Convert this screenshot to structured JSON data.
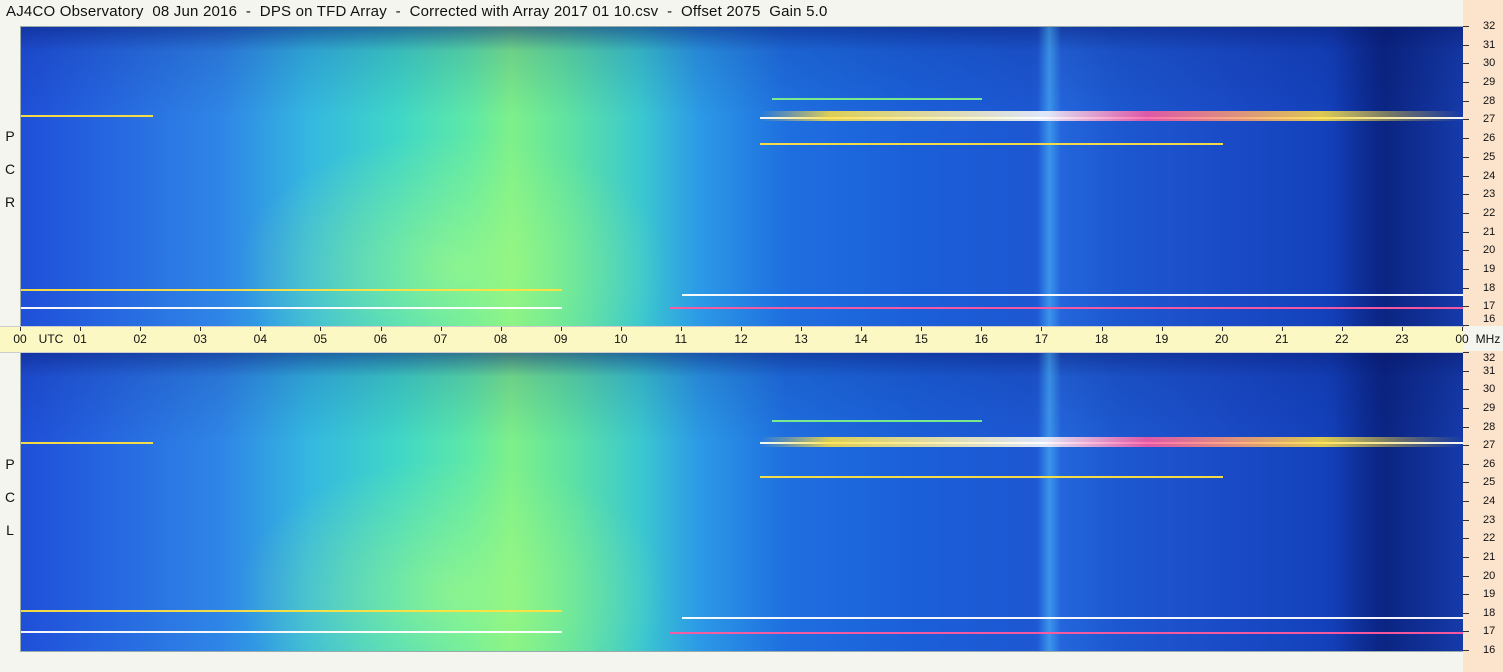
{
  "title": "AJ4CO Observatory  08 Jun 2016  -  DPS on TFD Array  -  Corrected with Array 2017 01 10.csv  -  Offset 2075  Gain 5.0",
  "time_axis": {
    "labels": [
      "00",
      "UTC",
      "01",
      "02",
      "03",
      "04",
      "05",
      "06",
      "07",
      "08",
      "09",
      "10",
      "11",
      "12",
      "13",
      "14",
      "15",
      "16",
      "17",
      "18",
      "19",
      "20",
      "21",
      "22",
      "23",
      "00",
      "MHz"
    ]
  },
  "panels": [
    {
      "polarization_letters": [
        "R",
        "C",
        "P"
      ]
    },
    {
      "polarization_letters": [
        "L",
        "C",
        "P"
      ]
    }
  ],
  "colors": {
    "background": "#f5f5f0",
    "time_axis_bg": "#fbf8c4",
    "freq_axis_bg": "#fbe3cc",
    "spectrum_low": "#0f35aa",
    "spectrum_mid": "#34b8e0",
    "spectrum_high": "#7ef08a",
    "burst_white": "#ffffff",
    "burst_magenta": "#ff5aa0",
    "burst_yellow": "#ffe040"
  },
  "chart_data": [
    {
      "type": "heatmap",
      "title": "",
      "xlabel": "UTC",
      "ylabel": "MHz",
      "x_ticks": [
        "00",
        "01",
        "02",
        "03",
        "04",
        "05",
        "06",
        "07",
        "08",
        "09",
        "10",
        "11",
        "12",
        "13",
        "14",
        "15",
        "16",
        "17",
        "18",
        "19",
        "20",
        "21",
        "22",
        "23",
        "00"
      ],
      "y_ticks": [
        32,
        31,
        30,
        29,
        28,
        27,
        26,
        25,
        24,
        23,
        22,
        21,
        20,
        19,
        18,
        17,
        16
      ],
      "ylim": [
        16,
        32
      ],
      "xlim": [
        0,
        24
      ],
      "side_label": "RCP",
      "streaks": [
        {
          "start": 0,
          "end": 2.2,
          "freq": 27.3,
          "color": "#ffe040"
        },
        {
          "start": 12.3,
          "end": 24,
          "freq": 27.2,
          "color": "#ffffff"
        },
        {
          "start": 11,
          "end": 24,
          "freq": 17.7,
          "color": "#ffffff"
        },
        {
          "start": 0,
          "end": 9,
          "freq": 17.0,
          "color": "#ffffff"
        },
        {
          "start": 10.8,
          "end": 24,
          "freq": 17.0,
          "color": "#ff5aa0"
        },
        {
          "start": 0,
          "end": 9,
          "freq": 18.0,
          "color": "#ffe040"
        },
        {
          "start": 12.3,
          "end": 20,
          "freq": 25.8,
          "color": "#ffe040"
        },
        {
          "start": 12.5,
          "end": 16,
          "freq": 28.2,
          "color": "#7ef08a"
        }
      ]
    },
    {
      "type": "heatmap",
      "title": "",
      "xlabel": "UTC",
      "ylabel": "MHz",
      "x_ticks": [
        "00",
        "01",
        "02",
        "03",
        "04",
        "05",
        "06",
        "07",
        "08",
        "09",
        "10",
        "11",
        "12",
        "13",
        "14",
        "15",
        "16",
        "17",
        "18",
        "19",
        "20",
        "21",
        "22",
        "23",
        "00"
      ],
      "y_ticks": [
        32,
        31,
        30,
        29,
        28,
        27,
        26,
        25,
        24,
        23,
        22,
        21,
        20,
        19,
        18,
        17,
        16
      ],
      "ylim": [
        16,
        32
      ],
      "xlim": [
        0,
        24
      ],
      "side_label": "LCP",
      "streaks": [
        {
          "start": 0,
          "end": 2.2,
          "freq": 27.2,
          "color": "#ffe040"
        },
        {
          "start": 12.3,
          "end": 24,
          "freq": 27.2,
          "color": "#ffffff"
        },
        {
          "start": 11,
          "end": 24,
          "freq": 17.8,
          "color": "#ffffff"
        },
        {
          "start": 0,
          "end": 9,
          "freq": 17.1,
          "color": "#ffffff"
        },
        {
          "start": 10.8,
          "end": 24,
          "freq": 17.0,
          "color": "#ff5aa0"
        },
        {
          "start": 0,
          "end": 9,
          "freq": 18.2,
          "color": "#ffe040"
        },
        {
          "start": 12.3,
          "end": 20,
          "freq": 25.4,
          "color": "#ffe040"
        },
        {
          "start": 12.5,
          "end": 16,
          "freq": 28.4,
          "color": "#7ef08a"
        }
      ]
    }
  ]
}
